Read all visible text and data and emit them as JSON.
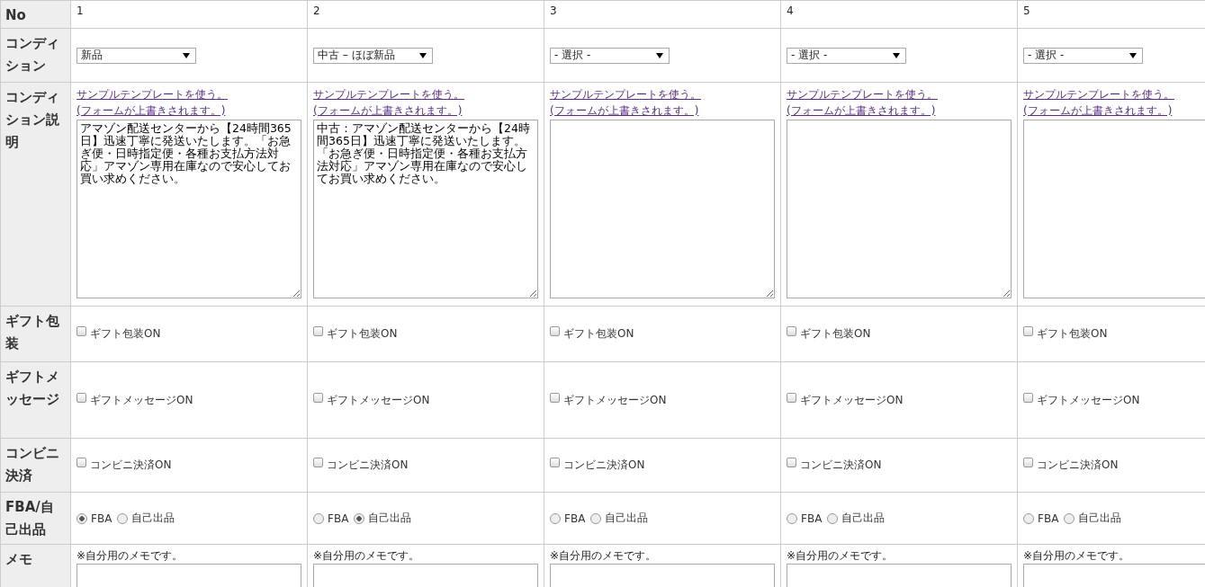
{
  "row_headers": {
    "no": "No",
    "condition": "コンディション",
    "description": "コンディション説明",
    "gift_wrap": "ギフト包装",
    "gift_message": "ギフトメッセージ",
    "conbini": "コンビニ決済",
    "fulfillment": "FBA/自己出品",
    "memo": "メモ"
  },
  "items": [
    {
      "no": "1",
      "condition": "新品",
      "template_link": [
        "サンプルテンプレートを使う。",
        "(フォームが上書きされます。)"
      ],
      "description": "アマゾン配送センターから【24時間365日】迅速丁寧に発送いたします。「お急ぎ便・日時指定便・各種お支払方法対応」アマゾン専用在庫なので安心してお買い求めください。",
      "gift_wrap": {
        "label": "ギフト包装ON",
        "checked": false
      },
      "gift_message": {
        "label": "ギフトメッセージON",
        "checked": false
      },
      "conbini": {
        "label": "コンビニ決済ON",
        "checked": false
      },
      "fulfillment": [
        {
          "label": "FBA",
          "selected": true
        },
        {
          "label": "自己出品",
          "selected": false
        }
      ],
      "memo_note": "※自分用のメモです。"
    },
    {
      "no": "2",
      "condition": "中古 – ほぼ新品",
      "template_link": [
        "サンプルテンプレートを使う。",
        "(フォームが上書きされます。)"
      ],
      "description": "中古：アマゾン配送センターから【24時間365日】迅速丁寧に発送いたします。「お急ぎ便・日時指定便・各種お支払方法対応」アマゾン専用在庫なので安心してお買い求めください。",
      "gift_wrap": {
        "label": "ギフト包装ON",
        "checked": false
      },
      "gift_message": {
        "label": "ギフトメッセージON",
        "checked": false
      },
      "conbini": {
        "label": "コンビニ決済ON",
        "checked": false
      },
      "fulfillment": [
        {
          "label": "FBA",
          "selected": false
        },
        {
          "label": "自己出品",
          "selected": true
        }
      ],
      "memo_note": "※自分用のメモです。"
    },
    {
      "no": "3",
      "condition": "- 選択 -",
      "template_link": [
        "サンプルテンプレートを使う。",
        "(フォームが上書きされます。)"
      ],
      "gift_wrap": {
        "label": "ギフト包装ON",
        "checked": false
      },
      "gift_message": {
        "label": "ギフトメッセージON",
        "checked": false
      },
      "conbini": {
        "label": "コンビニ決済ON",
        "checked": false
      },
      "fulfillment": [
        {
          "label": "FBA",
          "selected": false
        },
        {
          "label": "自己出品",
          "selected": false
        }
      ],
      "memo_note": "※自分用のメモです。"
    },
    {
      "no": "4",
      "condition": "- 選択 -",
      "template_link": [
        "サンプルテンプレートを使う。",
        "(フォームが上書きされます。)"
      ],
      "gift_wrap": {
        "label": "ギフト包装ON",
        "checked": false
      },
      "gift_message": {
        "label": "ギフトメッセージON",
        "checked": false
      },
      "conbini": {
        "label": "コンビニ決済ON",
        "checked": false
      },
      "fulfillment": [
        {
          "label": "FBA",
          "selected": false
        },
        {
          "label": "自己出品",
          "selected": false
        }
      ],
      "memo_note": "※自分用のメモです。"
    },
    {
      "no": "5",
      "condition": "- 選択 -",
      "template_link": [
        "サンプルテンプレートを使う。",
        "(フォームが上書きされます。)"
      ],
      "gift_wrap": {
        "label": "ギフト包装ON",
        "checked": false
      },
      "gift_message": {
        "label": "ギフトメッセージON",
        "checked": false
      },
      "conbini": {
        "label": "コンビニ決済ON",
        "checked": false
      },
      "fulfillment": [
        {
          "label": "FBA",
          "selected": false
        },
        {
          "label": "自己出品",
          "selected": false
        }
      ],
      "memo_note": "※自分用のメモです。"
    }
  ]
}
